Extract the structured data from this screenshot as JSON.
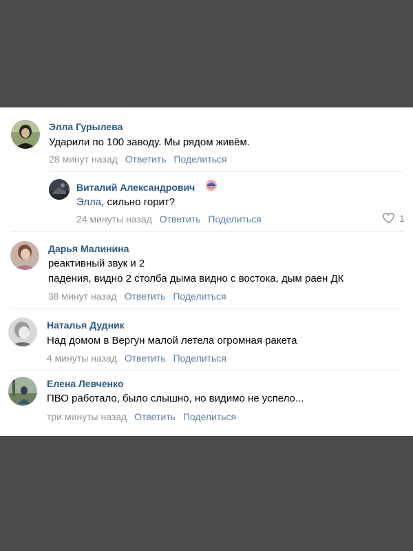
{
  "comments": [
    {
      "author": "Элла Гурылева",
      "text": "Ударили по 100 заводу. Мы рядом живём.",
      "time": "28 минут назад",
      "reply": "Ответить",
      "share": "Поделиться"
    },
    {
      "author": "Виталий Александрович",
      "mention": "Элла",
      "text": ", сильно горит?",
      "time": "24 минуты назад",
      "reply": "Ответить",
      "share": "Поделиться",
      "likes": "1",
      "badge_icon": "helmet-badge-icon"
    },
    {
      "author": "Дарья Малинина",
      "text_lines": [
        "реактивный звук и 2",
        "падения, видно 2 столба дыма видно с востока, дым раен ДК"
      ],
      "time": "38 минут назад",
      "reply": "Ответить",
      "share": "Поделиться"
    },
    {
      "author": "Наталья Дудник",
      "text": "Над домом в Вергун малой летела огромная ракета",
      "time": "4 минуты назад",
      "reply": "Ответить",
      "share": "Поделиться"
    },
    {
      "author": "Елена Левченко",
      "text": "ПВО работало, было слышно, но видимо не успело...",
      "time": "три минуты назад",
      "reply": "Ответить",
      "share": "Поделиться"
    }
  ],
  "colors": {
    "link": "#2a5885",
    "action": "#5b7ea6",
    "muted": "#939393",
    "backdrop": "#4b4b4b"
  },
  "icons": [
    "heart-icon",
    "helmet-badge-icon"
  ]
}
